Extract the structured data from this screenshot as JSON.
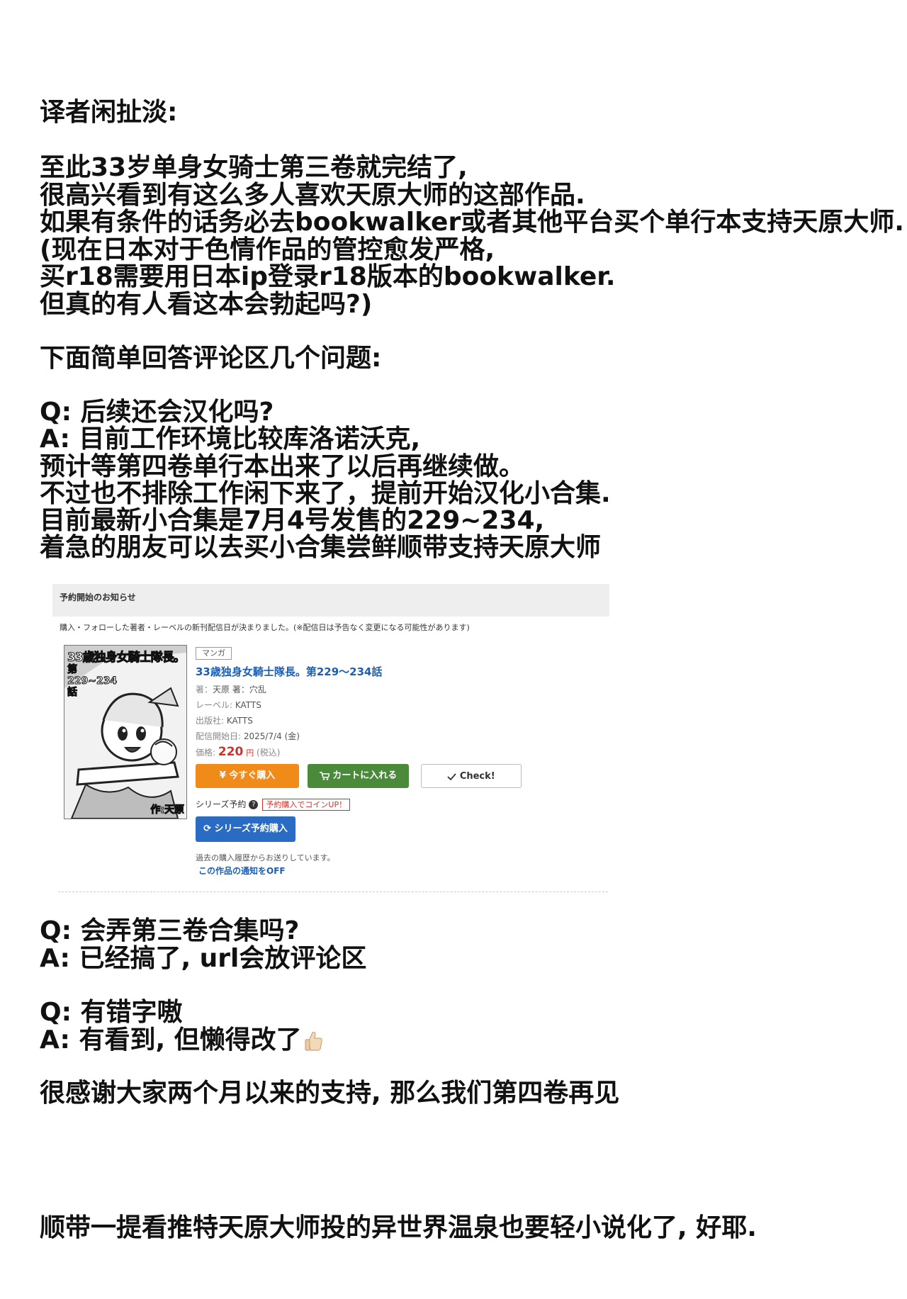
{
  "heading": "译者闲扯淡:",
  "para1": [
    "至此33岁单身女骑士第三卷就完结了,",
    "很高兴看到有这么多人喜欢天原大师的这部作品.",
    "如果有条件的话务必去bookwalker或者其他平台买个单行本支持天原大师.",
    "(现在日本对于色情作品的管控愈发严格,",
    "买r18需要用日本ip登录r18版本的bookwalker.",
    "但真的有人看这本会勃起吗?)"
  ],
  "para2": "下面简单回答评论区几个问题:",
  "qa1": [
    "Q: 后续还会汉化吗?",
    "A: 目前工作环境比较库洛诺沃克,",
    "预计等第四卷单行本出来了以后再继续做。",
    "不过也不排除工作闲下来了，提前开始汉化小合集.",
    "目前最新小合集是7月4号发售的229~234,",
    "着急的朋友可以去买小合集尝鲜顺带支持天原大师"
  ],
  "store": {
    "header": "予約開始のお知らせ",
    "notice": "購入・フォローした著者・レーベルの新刊配信日が決まりました。(※配信日は予告なく変更になる可能性があります)",
    "cover_title": "33歳独身女騎士隊長。",
    "cover_chapters": "第229~234話",
    "cover_author": "作:天原",
    "genre_tag": "マンガ",
    "product_title": "33歳独身女騎士隊長。第229～234話",
    "author_label": "著：",
    "author_value": "天原 著：穴乱",
    "label_key": "レーベル:",
    "label_value": "KATTS",
    "publisher_key": "出版社:",
    "publisher_value": "KATTS",
    "release_key": "配信開始日:",
    "release_value": "2025/7/4 (金)",
    "price_key": "価格:",
    "price_value": "220",
    "price_unit": "円",
    "price_tax": "(税込)",
    "buy_now": "今すぐ購入",
    "add_cart": "カートに入れる",
    "check": "Check!",
    "series_reserve": "シリーズ予約",
    "coin_badge": "予約購入でコインUP！",
    "series_reserve_buy": "シリーズ予約購入",
    "history_text": "過去の購入履歴からお送りしています。",
    "notify_off": "この作品の通知をOFF"
  },
  "qa2": [
    "Q: 会弄第三卷合集吗?",
    "A: 已经搞了, url会放评论区"
  ],
  "qa3": [
    "Q: 有错字嗷",
    "A: 有看到, 但懒得改了"
  ],
  "closing": "很感谢大家两个月以来的支持, 那么我们第四卷再见",
  "footer": "顺带一提看推特天原大师投的异世界温泉也要轻小说化了, 好耶."
}
